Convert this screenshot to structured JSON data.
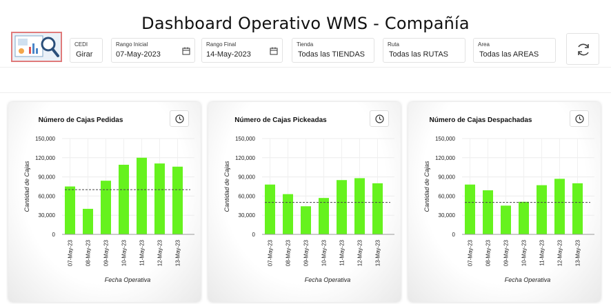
{
  "header": {
    "title": "Dashboard Operativo WMS - Compañía"
  },
  "filters": {
    "cedi": {
      "label": "CEDI",
      "value": "Girar"
    },
    "rango_inicial": {
      "label": "Rango Inicial",
      "value": "07-May-2023"
    },
    "rango_final": {
      "label": "Rango Final",
      "value": "14-May-2023"
    },
    "tienda": {
      "label": "Tienda",
      "value": "Todas las TIENDAS"
    },
    "ruta": {
      "label": "Ruta",
      "value": "Todas las RUTAS"
    },
    "area": {
      "label": "Area",
      "value": "Todas las AREAS"
    }
  },
  "icons": {
    "logo": "analytics-magnifier-icon",
    "calendar": "calendar-icon",
    "refresh": "refresh-icon",
    "clock": "clock-icon"
  },
  "colors": {
    "bar": "#66f21e",
    "reference_line": "#444444",
    "accent_border": "#e07a7a"
  },
  "chart_data": [
    {
      "type": "bar",
      "title": "Número de Cajas Pedidas",
      "xlabel": "Fecha Operativa",
      "ylabel": "Cantidad de Cajas",
      "ylim": [
        0,
        150000
      ],
      "yticks": [
        "0",
        "30,000",
        "60,000",
        "90,000",
        "120,000",
        "150,000"
      ],
      "categories": [
        "07-May-23",
        "08-May-23",
        "09-May-23",
        "10-May-23",
        "11-May-23",
        "12-May-23",
        "13-May-23"
      ],
      "values": [
        75000,
        40000,
        84000,
        109000,
        120000,
        111000,
        106000
      ],
      "reference_line": 70000,
      "grid": true
    },
    {
      "type": "bar",
      "title": "Número de Cajas Pickeadas",
      "xlabel": "Fecha Operativa",
      "ylabel": "Cantidad de Cajas",
      "ylim": [
        0,
        150000
      ],
      "yticks": [
        "0",
        "30,000",
        "60,000",
        "90,000",
        "120,000",
        "150,000"
      ],
      "categories": [
        "07-May-23",
        "08-May-23",
        "09-May-23",
        "10-May-23",
        "11-May-23",
        "12-May-23",
        "13-May-23"
      ],
      "values": [
        78000,
        63000,
        44000,
        57000,
        85000,
        88000,
        80000
      ],
      "reference_line": 50000,
      "grid": true
    },
    {
      "type": "bar",
      "title": "Número de Cajas Despachadas",
      "xlabel": "Fecha Operativa",
      "ylabel": "Cantidad de Cajas",
      "ylim": [
        0,
        150000
      ],
      "yticks": [
        "0",
        "30,000",
        "60,000",
        "90,000",
        "120,000",
        "150,000"
      ],
      "categories": [
        "07-May-23",
        "08-May-23",
        "09-May-23",
        "10-May-23",
        "11-May-23",
        "12-May-23",
        "13-May-23"
      ],
      "values": [
        78000,
        69000,
        45000,
        51000,
        77000,
        87000,
        80000
      ],
      "reference_line": 50000,
      "grid": true
    }
  ]
}
